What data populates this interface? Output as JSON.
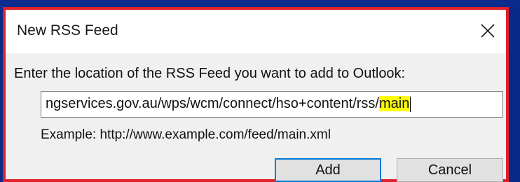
{
  "dialog": {
    "title": "New RSS Feed",
    "close_icon": "close-icon",
    "prompt": "Enter the location of the RSS Feed you want to add to Outlook:",
    "url_value_prefix": "ngservices.gov.au/wps/wcm/connect/hso+content/rss/",
    "url_value_highlight": "main",
    "example": "Example: http://www.example.com/feed/main.xml",
    "add_label": "Add",
    "cancel_label": "Cancel"
  },
  "colors": {
    "border_highlight": "#e0202a",
    "text_highlight": "#ffff00",
    "default_button_border": "#0078d7"
  }
}
